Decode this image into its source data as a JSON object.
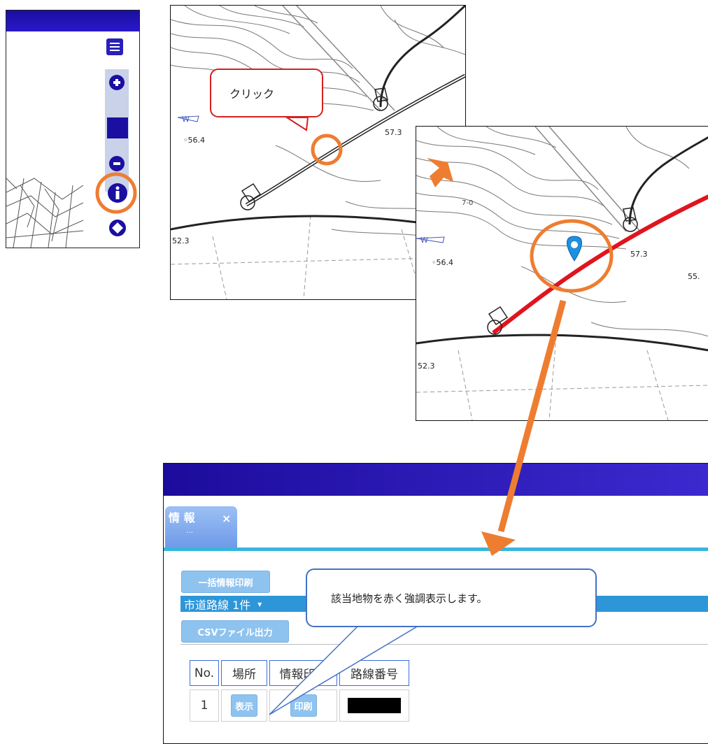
{
  "toolbar": {
    "icons": [
      "menu-icon",
      "zoom-in-icon",
      "zoom-slider-handle",
      "zoom-out-icon",
      "info-icon",
      "layers-icon"
    ]
  },
  "map1": {
    "elevation_left": "◦56.4",
    "elevation_right": "57.3",
    "elevation_bottom": "52.3",
    "water_label": "W"
  },
  "map2": {
    "elevation_left": "◦56.4",
    "elevation_right": "57.3",
    "elevation_far": "55.",
    "elevation_bottom": "52.3",
    "contour_label": "7-0",
    "water_label": "W"
  },
  "callouts": {
    "click": "クリック",
    "highlight": "該当地物を赤く強調表示します。"
  },
  "app": {
    "tab_label": "情 報",
    "tab_sub": "…",
    "tab_close": "×",
    "bulk_print_label": "一括情報印刷",
    "route_dropdown_label": "市道路線 1件",
    "route_dropdown_caret": "▾",
    "csv_button_label": "CSVファイル出力",
    "table": {
      "headers": [
        "No.",
        "場所",
        "情報印刷",
        "路線番号"
      ],
      "rows": [
        {
          "no": "1",
          "location_button": "表示",
          "print_button": "印刷",
          "route_number": "■"
        }
      ]
    }
  },
  "colors": {
    "header_blue": "#1a0fa0",
    "highlight_orange": "#ee7d31",
    "route_red": "#e0141e",
    "pin_blue": "#1e90e0",
    "tab_accent": "#38b5dd"
  }
}
